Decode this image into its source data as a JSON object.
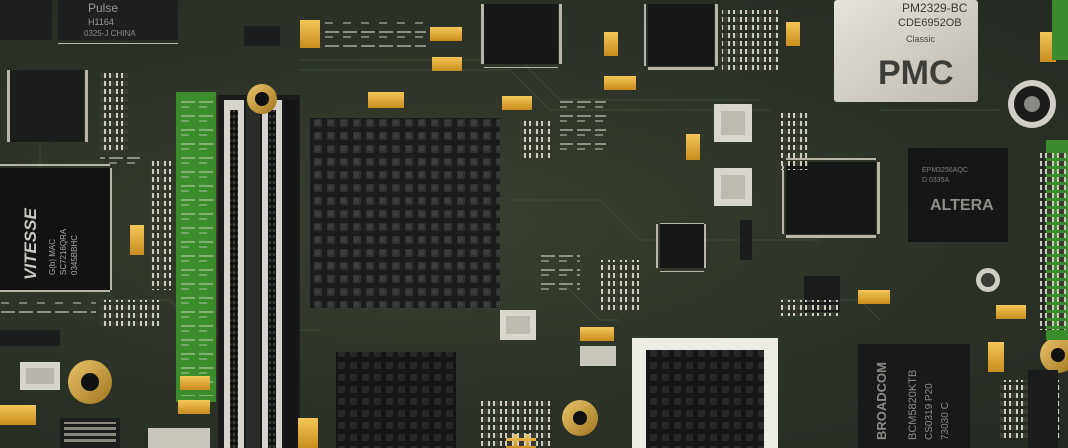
{
  "photo": {
    "subject": "circuit board"
  },
  "chips": {
    "pulse_brand": "Pulse",
    "pulse_part": "H1164",
    "pulse_origin": "0325-J CHINA",
    "vitesse_brand": "VITESSE",
    "vitesse_line1": "G(b) MAC",
    "vitesse_line2": "SC7216QRA",
    "vitesse_line3": "0345BBHC",
    "pmc_part": "PM2329-BC",
    "pmc_code": "CDE6952OB",
    "pmc_logo": "PMC",
    "pmc_sub": "Classic",
    "altera_logo": "ALTERA",
    "altera_line1": "EPM3256AQC",
    "altera_line2": "D 0335A",
    "broadcom_logo": "BROADCOM",
    "broadcom_part": "BCM5820KTB",
    "broadcom_line2": "CS0319 P20",
    "broadcom_line3": "73030 C"
  }
}
